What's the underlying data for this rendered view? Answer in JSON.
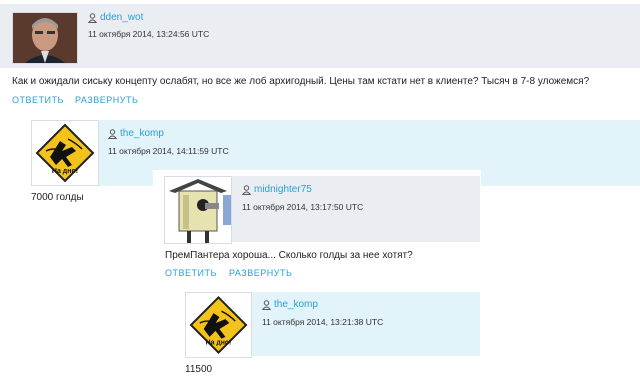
{
  "comments": [
    {
      "user": "dden_wot",
      "timestamp": "11 октября 2014, 13:24:56 UTC",
      "text": "Как и ожидали сиську концепту ослабят, но все же лоб архигодный. Цены там кстати нет в клиенте? Тысяч в 7-8 уложемся?",
      "actions": {
        "reply": "ОТВЕТИТЬ",
        "expand": "РАЗВЕРНУТЬ"
      }
    },
    {
      "user": "the_komp",
      "timestamp": "11 октября 2014, 14:11:59 UTC",
      "text": "7000 голды",
      "avatar_label": "На дно!"
    },
    {
      "user": "midnighter75",
      "timestamp": "11 октября 2014, 13:17:50 UTC",
      "text": "ПремПантера хороша... Сколько голды за нее хотят?",
      "actions": {
        "reply": "ОТВЕТИТЬ",
        "expand": "РАЗВЕРНУТЬ"
      }
    },
    {
      "user": "the_komp",
      "timestamp": "11 октября 2014, 13:21:38 UTC",
      "text": "11500",
      "avatar_label": "На дно!"
    }
  ],
  "colors": {
    "link": "#2a9fd6",
    "header_bg": "#eaeef2",
    "highlight_bg": "#e3f3fa",
    "sign_yellow": "#f3c31b"
  }
}
